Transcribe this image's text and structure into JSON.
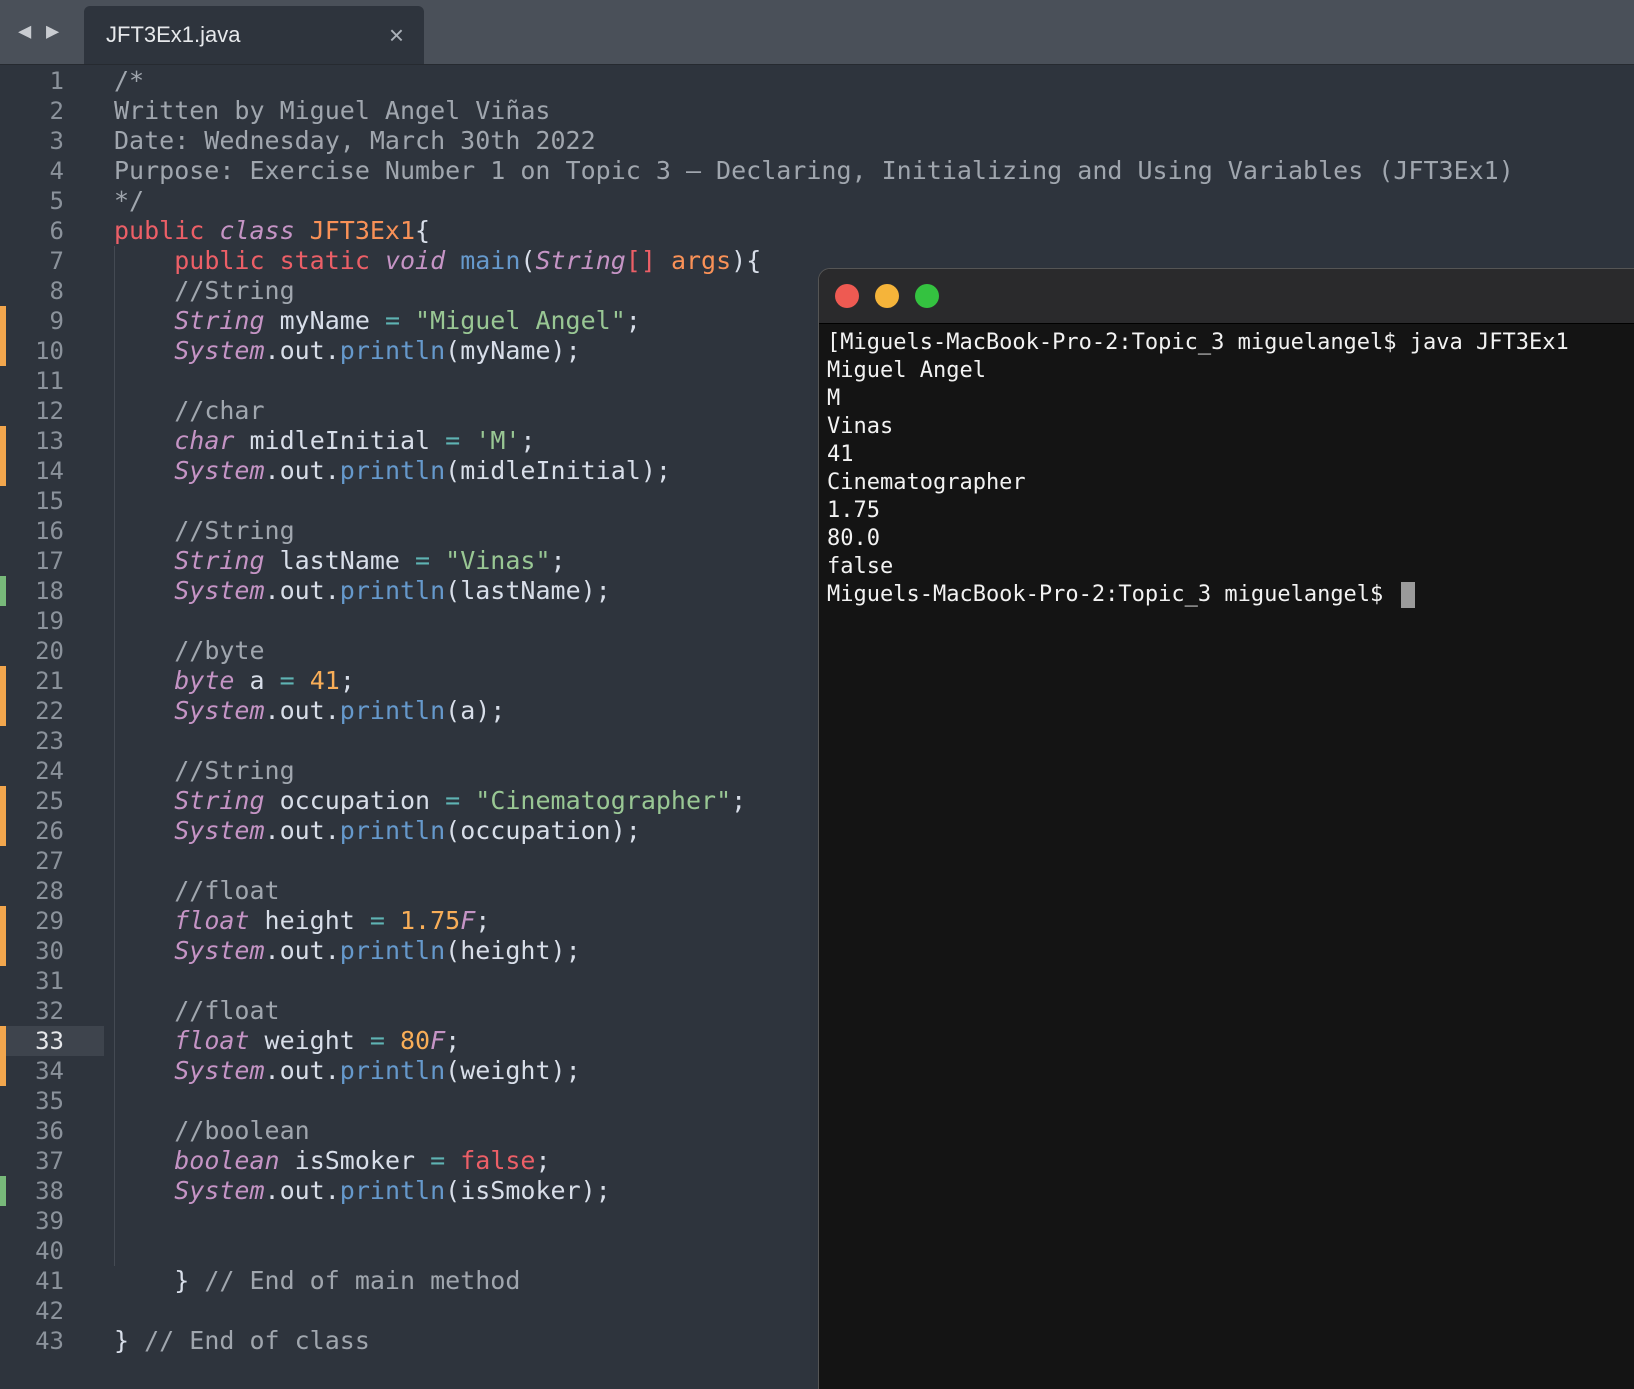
{
  "tabbar": {
    "nav_back": "◀",
    "nav_forward": "▶",
    "tab_title": "JFT3Ex1.java",
    "close": "×"
  },
  "editor": {
    "current_line": 33,
    "line_numbers": [
      "1",
      "2",
      "3",
      "4",
      "5",
      "6",
      "7",
      "8",
      "9",
      "10",
      "11",
      "12",
      "13",
      "14",
      "15",
      "16",
      "17",
      "18",
      "19",
      "20",
      "21",
      "22",
      "23",
      "24",
      "25",
      "26",
      "27",
      "28",
      "29",
      "30",
      "31",
      "32",
      "33",
      "34",
      "35",
      "36",
      "37",
      "38",
      "39",
      "40",
      "41",
      "42",
      "43"
    ],
    "modified_lines": [
      {
        "line": 9,
        "color": "orange"
      },
      {
        "line": 10,
        "color": "orange"
      },
      {
        "line": 13,
        "color": "orange"
      },
      {
        "line": 14,
        "color": "orange"
      },
      {
        "line": 18,
        "color": "green"
      },
      {
        "line": 21,
        "color": "orange"
      },
      {
        "line": 22,
        "color": "orange"
      },
      {
        "line": 25,
        "color": "orange"
      },
      {
        "line": 26,
        "color": "orange"
      },
      {
        "line": 29,
        "color": "orange"
      },
      {
        "line": 30,
        "color": "orange"
      },
      {
        "line": 33,
        "color": "orange"
      },
      {
        "line": 34,
        "color": "orange"
      },
      {
        "line": 38,
        "color": "green"
      }
    ],
    "lines": [
      [
        [
          "cm",
          "/*"
        ]
      ],
      [
        [
          "cm",
          "Written by Miguel Angel Viñas"
        ]
      ],
      [
        [
          "cm",
          "Date: Wednesday, March 30th 2022"
        ]
      ],
      [
        [
          "cm",
          "Purpose: Exercise Number 1 on Topic 3 – Declaring, Initializing and Using Variables (JFT3Ex1)"
        ]
      ],
      [
        [
          "cm",
          "*/"
        ]
      ],
      [
        [
          "kw",
          "public "
        ],
        [
          "ty",
          "class "
        ],
        [
          "cls",
          "JFT3Ex1"
        ],
        [
          "pl",
          "{"
        ]
      ],
      [
        [
          "pl",
          "    "
        ],
        [
          "kw",
          "public static "
        ],
        [
          "ty",
          "void "
        ],
        [
          "fn",
          "main"
        ],
        [
          "pl",
          "("
        ],
        [
          "ty",
          "String"
        ],
        [
          "kw",
          "[] "
        ],
        [
          "cls",
          "args"
        ],
        [
          "pl",
          "){"
        ]
      ],
      [
        [
          "pl",
          "    "
        ],
        [
          "cm",
          "//String"
        ]
      ],
      [
        [
          "pl",
          "    "
        ],
        [
          "ty",
          "String "
        ],
        [
          "pl",
          "myName "
        ],
        [
          "op",
          "= "
        ],
        [
          "st",
          "\"Miguel Angel\""
        ],
        [
          "pl",
          ";"
        ]
      ],
      [
        [
          "pl",
          "    "
        ],
        [
          "ty",
          "System"
        ],
        [
          "pl",
          ".out."
        ],
        [
          "fn",
          "println"
        ],
        [
          "pl",
          "(myName);"
        ]
      ],
      [],
      [
        [
          "pl",
          "    "
        ],
        [
          "cm",
          "//char"
        ]
      ],
      [
        [
          "pl",
          "    "
        ],
        [
          "ty",
          "char "
        ],
        [
          "pl",
          "midleInitial "
        ],
        [
          "op",
          "= "
        ],
        [
          "st",
          "'M'"
        ],
        [
          "pl",
          ";"
        ]
      ],
      [
        [
          "pl",
          "    "
        ],
        [
          "ty",
          "System"
        ],
        [
          "pl",
          ".out."
        ],
        [
          "fn",
          "println"
        ],
        [
          "pl",
          "(midleInitial);"
        ]
      ],
      [],
      [
        [
          "pl",
          "    "
        ],
        [
          "cm",
          "//String"
        ]
      ],
      [
        [
          "pl",
          "    "
        ],
        [
          "ty",
          "String "
        ],
        [
          "pl",
          "lastName "
        ],
        [
          "op",
          "= "
        ],
        [
          "st",
          "\"Vinas\""
        ],
        [
          "pl",
          ";"
        ]
      ],
      [
        [
          "pl",
          "    "
        ],
        [
          "ty",
          "System"
        ],
        [
          "pl",
          ".out."
        ],
        [
          "fn",
          "println"
        ],
        [
          "pl",
          "(lastName);"
        ]
      ],
      [],
      [
        [
          "pl",
          "    "
        ],
        [
          "cm",
          "//byte"
        ]
      ],
      [
        [
          "pl",
          "    "
        ],
        [
          "ty",
          "byte "
        ],
        [
          "pl",
          "a "
        ],
        [
          "op",
          "= "
        ],
        [
          "nu",
          "41"
        ],
        [
          "pl",
          ";"
        ]
      ],
      [
        [
          "pl",
          "    "
        ],
        [
          "ty",
          "System"
        ],
        [
          "pl",
          ".out."
        ],
        [
          "fn",
          "println"
        ],
        [
          "pl",
          "(a);"
        ]
      ],
      [],
      [
        [
          "pl",
          "    "
        ],
        [
          "cm",
          "//String"
        ]
      ],
      [
        [
          "pl",
          "    "
        ],
        [
          "ty",
          "String "
        ],
        [
          "pl",
          "occupation "
        ],
        [
          "op",
          "= "
        ],
        [
          "st",
          "\"Cinematographer\""
        ],
        [
          "pl",
          ";"
        ]
      ],
      [
        [
          "pl",
          "    "
        ],
        [
          "ty",
          "System"
        ],
        [
          "pl",
          ".out."
        ],
        [
          "fn",
          "println"
        ],
        [
          "pl",
          "(occupation);"
        ]
      ],
      [],
      [
        [
          "pl",
          "    "
        ],
        [
          "cm",
          "//float"
        ]
      ],
      [
        [
          "pl",
          "    "
        ],
        [
          "ty",
          "float "
        ],
        [
          "pl",
          "height "
        ],
        [
          "op",
          "= "
        ],
        [
          "nu",
          "1.75"
        ],
        [
          "ty",
          "F"
        ],
        [
          "pl",
          ";"
        ]
      ],
      [
        [
          "pl",
          "    "
        ],
        [
          "ty",
          "System"
        ],
        [
          "pl",
          ".out."
        ],
        [
          "fn",
          "println"
        ],
        [
          "pl",
          "(height);"
        ]
      ],
      [],
      [
        [
          "pl",
          "    "
        ],
        [
          "cm",
          "//float"
        ]
      ],
      [
        [
          "pl",
          "    "
        ],
        [
          "ty",
          "float "
        ],
        [
          "pl",
          "weight "
        ],
        [
          "op",
          "= "
        ],
        [
          "nu",
          "80"
        ],
        [
          "ty",
          "F"
        ],
        [
          "pl",
          ";"
        ]
      ],
      [
        [
          "pl",
          "    "
        ],
        [
          "ty",
          "System"
        ],
        [
          "pl",
          ".out."
        ],
        [
          "fn",
          "println"
        ],
        [
          "pl",
          "(weight);"
        ]
      ],
      [],
      [
        [
          "pl",
          "    "
        ],
        [
          "cm",
          "//boolean"
        ]
      ],
      [
        [
          "pl",
          "    "
        ],
        [
          "ty",
          "boolean "
        ],
        [
          "pl",
          "isSmoker "
        ],
        [
          "op",
          "= "
        ],
        [
          "kw",
          "false"
        ],
        [
          "pl",
          ";"
        ]
      ],
      [
        [
          "pl",
          "    "
        ],
        [
          "ty",
          "System"
        ],
        [
          "pl",
          ".out."
        ],
        [
          "fn",
          "println"
        ],
        [
          "pl",
          "(isSmoker);"
        ]
      ],
      [],
      [],
      [
        [
          "pl",
          "    } "
        ],
        [
          "cm",
          "// End of main method"
        ]
      ],
      [],
      [
        [
          "pl",
          "} "
        ],
        [
          "cm",
          "// End of class"
        ]
      ]
    ]
  },
  "terminal": {
    "lines": [
      "[Miguels-MacBook-Pro-2:Topic_3 miguelangel$ java JFT3Ex1",
      "Miguel Angel",
      "M",
      "Vinas",
      "41",
      "Cinematographer",
      "1.75",
      "80.0",
      "false"
    ],
    "prompt": "Miguels-MacBook-Pro-2:Topic_3 miguelangel$ "
  },
  "colors": {
    "editor_bg": "#2e343d",
    "terminal_bg": "#141414",
    "modified_orange": "#f2a64d",
    "modified_green": "#78b97a"
  }
}
